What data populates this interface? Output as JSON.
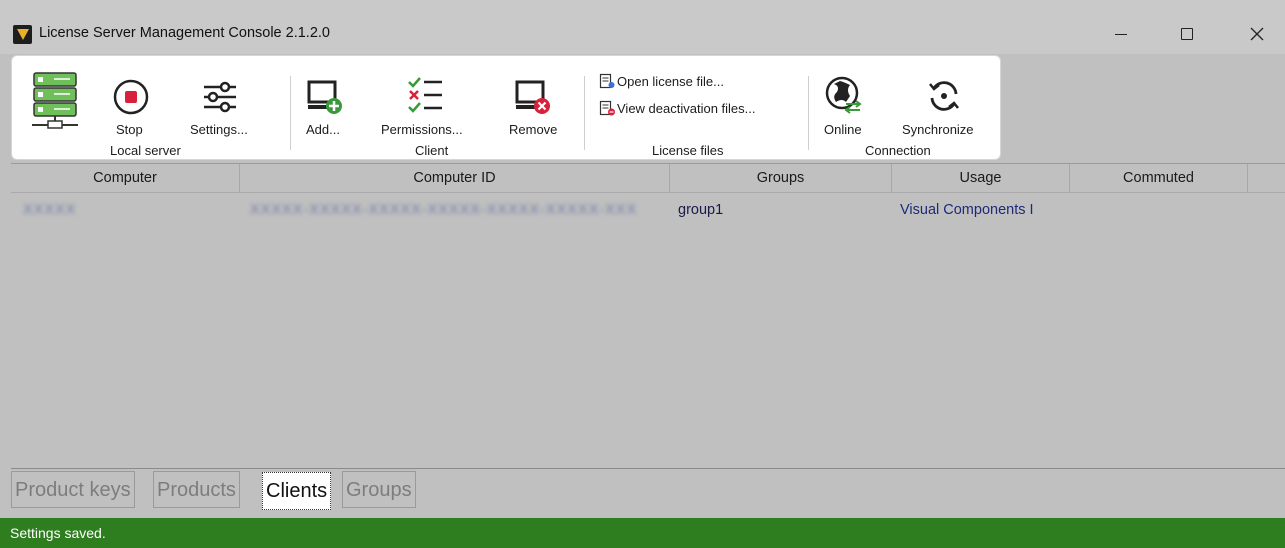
{
  "window": {
    "title": "License Server Management Console 2.1.2.0"
  },
  "ribbon": {
    "local_server": {
      "group_label": "Local server",
      "stop_label": "Stop",
      "settings_label": "Settings..."
    },
    "client": {
      "group_label": "Client",
      "add_label": "Add...",
      "permissions_label": "Permissions...",
      "remove_label": "Remove"
    },
    "license_files": {
      "group_label": "License files",
      "open_label": "Open license file...",
      "view_deactivation_label": "View deactivation files..."
    },
    "connection": {
      "group_label": "Connection",
      "online_label": "Online",
      "synchronize_label": "Synchronize"
    }
  },
  "grid": {
    "columns": [
      "Computer",
      "Computer ID",
      "Groups",
      "Usage",
      "Commuted"
    ],
    "rows": [
      {
        "computer": "XXXXX",
        "computer_id": "XXXXX-XXXXX-XXXXX-XXXXX-XXXXX-XXXXX-XXX",
        "groups": "group1",
        "usage": "Visual Components I",
        "commuted": ""
      }
    ]
  },
  "tabs": [
    "Product keys",
    "Products",
    "Clients",
    "Groups"
  ],
  "active_tab": "Clients",
  "status": {
    "text": "Settings saved.",
    "color": "#2e7d1f"
  },
  "icons": {
    "app": "visual-components-logo",
    "server": "server-stack-icon",
    "stop": "stop-icon",
    "settings": "sliders-icon",
    "add_client": "monitor-add-icon",
    "permissions": "checklist-icon",
    "remove_client": "monitor-remove-icon",
    "open_license": "document-lock-icon",
    "view_deactivation": "document-remove-icon",
    "online": "globe-sync-icon",
    "synchronize": "sync-icon"
  }
}
